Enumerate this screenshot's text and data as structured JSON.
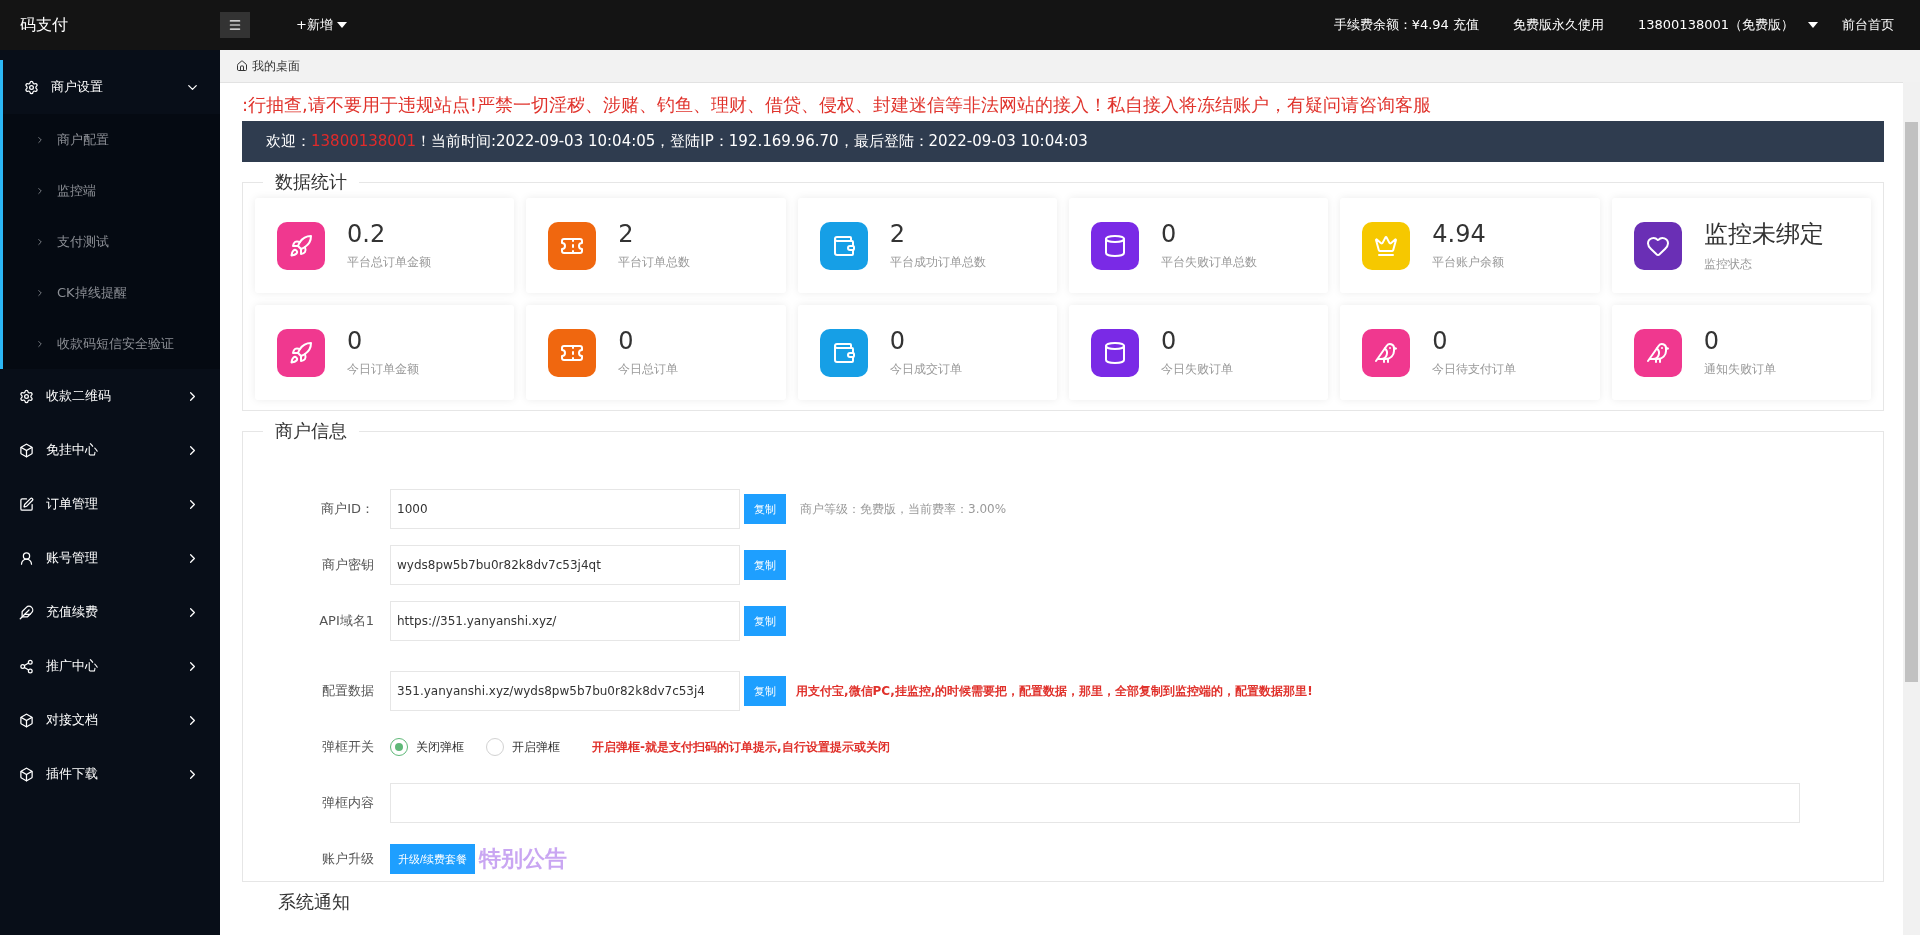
{
  "topbar": {
    "brand": "码支付",
    "new_menu": "+新增",
    "fee_balance": "手续费余额：¥4.94 充值",
    "plan": "免费版永久使用",
    "user": "13800138001（免费版）",
    "home_link": "前台首页"
  },
  "sidebar": {
    "items": [
      {
        "label": "商户设置",
        "expanded": true,
        "children": [
          {
            "label": "商户配置"
          },
          {
            "label": "监控端"
          },
          {
            "label": "支付测试"
          },
          {
            "label": "CK掉线提醒"
          },
          {
            "label": "收款码短信安全验证"
          }
        ]
      },
      {
        "label": "收款二维码",
        "expanded": false
      },
      {
        "label": "免挂中心",
        "expanded": false
      },
      {
        "label": "订单管理",
        "expanded": false
      },
      {
        "label": "账号管理",
        "expanded": false
      },
      {
        "label": "充值续费",
        "expanded": false
      },
      {
        "label": "推广中心",
        "expanded": false
      },
      {
        "label": "对接文档",
        "expanded": false
      },
      {
        "label": "插件下载",
        "expanded": false
      }
    ]
  },
  "breadcrumb": "我的桌面",
  "notice": ":行抽查,请不要用于违规站点!严禁一切淫秽、涉赌、钓鱼、理财、借贷、侵权、封建迷信等非法网站的接入！私自接入将冻结账户，有疑问请咨询客服",
  "welcome": {
    "prefix": "欢迎：",
    "username": "13800138001",
    "rest": "！当前时间:2022-09-03 10:04:05，登陆IP：192.169.96.70，最后登陆：2022-09-03 10:04:03"
  },
  "stats": {
    "title": "数据统计",
    "cards": [
      {
        "value": "0.2",
        "label": "平台总订单金额",
        "kind": "rocket",
        "color": "#f0388f"
      },
      {
        "value": "2",
        "label": "平台订单总数",
        "kind": "ticket",
        "color": "#f0670f"
      },
      {
        "value": "2",
        "label": "平台成功订单总数",
        "kind": "wallet",
        "color": "#169fe6"
      },
      {
        "value": "0",
        "label": "平台失败订单总数",
        "kind": "cylinder",
        "color": "#7a2ae6"
      },
      {
        "value": "4.94",
        "label": "平台账户余额",
        "kind": "crown",
        "color": "#f6c800"
      },
      {
        "value": "监控未绑定",
        "label": "监控状态",
        "kind": "heart",
        "color": "#6a2fb5"
      },
      {
        "value": "0",
        "label": "今日订单金额",
        "kind": "rocket",
        "color": "#f0388f"
      },
      {
        "value": "0",
        "label": "今日总订单",
        "kind": "ticket",
        "color": "#f0670f"
      },
      {
        "value": "0",
        "label": "今日成交订单",
        "kind": "wallet",
        "color": "#169fe6"
      },
      {
        "value": "0",
        "label": "今日失败订单",
        "kind": "cylinder",
        "color": "#7a2ae6"
      },
      {
        "value": "0",
        "label": "今日待支付订单",
        "kind": "bird",
        "color": "#f0388f"
      },
      {
        "value": "0",
        "label": "通知失败订单",
        "kind": "bird",
        "color": "#f0388f"
      }
    ]
  },
  "merchant": {
    "title": "商户信息",
    "rows": [
      {
        "kind": "copy",
        "label": "商户ID：",
        "value": "1000",
        "button": "复制",
        "note": "商户等级：免费版，当前费率：3.00%"
      },
      {
        "kind": "copy",
        "label": "商户密钥",
        "value": "wyds8pw5b7bu0r82k8dv7c53j4qt",
        "button": "复制"
      },
      {
        "kind": "copy",
        "label": "API域名1",
        "value": "https://351.yanyanshi.xyz/",
        "button": "复制"
      },
      {
        "kind": "copy",
        "label": "配置数据",
        "value": "351.yanyanshi.xyz/wyds8pw5b7bu0r82k8dv7c53j4",
        "button": "复制",
        "warning": "用支付宝,微信PC,挂监控,的时候需要把，配置数据，那里，全部复制到监控端的，配置数据那里!"
      },
      {
        "kind": "radio",
        "label": "弹框开关",
        "options": [
          {
            "label": "关闭弹框",
            "selected": true
          },
          {
            "label": "开启弹框",
            "selected": false
          }
        ],
        "warning": "开启弹框-就是支付扫码的订单提示,自行设置提示或关闭"
      },
      {
        "kind": "wide",
        "label": "弹框内容"
      },
      {
        "kind": "upgrade",
        "label": "账户升级",
        "button": "升级/续费套餐",
        "badge": "特别公告"
      }
    ]
  },
  "system_notice": {
    "title": "系统通知"
  }
}
